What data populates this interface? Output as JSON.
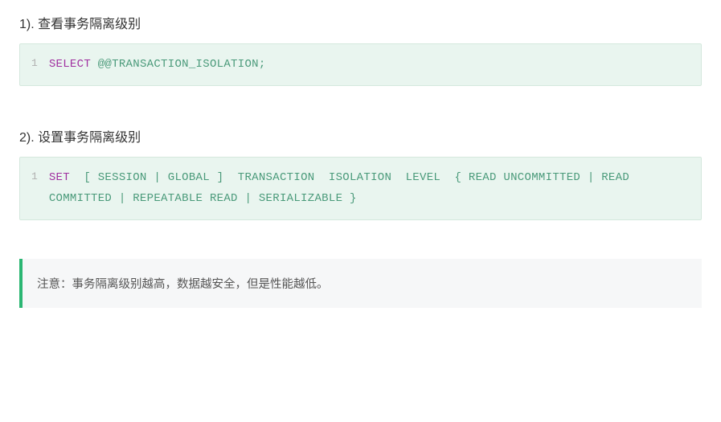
{
  "section1": {
    "heading": "1). 查看事务隔离级别",
    "line_no": "1",
    "kw": "SELECT",
    "rest": " @@TRANSACTION_ISOLATION;"
  },
  "section2": {
    "heading": "2). 设置事务隔离级别",
    "line_no": "1",
    "kw": "SET",
    "rest": "  [ SESSION | GLOBAL ]  TRANSACTION  ISOLATION  LEVEL  { READ UNCOMMITTED | READ COMMITTED | REPEATABLE READ | SERIALIZABLE }"
  },
  "note": "注意：事务隔离级别越高，数据越安全，但是性能越低。"
}
